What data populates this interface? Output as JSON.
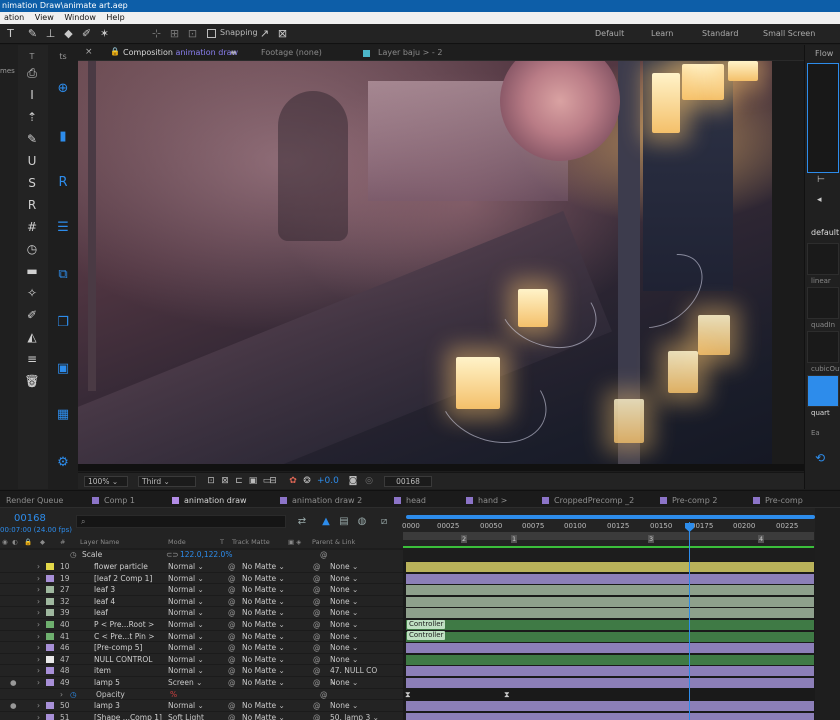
{
  "window": {
    "title": "nimation Draw\\animate art.aep"
  },
  "menu": [
    "ation",
    "View",
    "Window",
    "Help"
  ],
  "toolbar": {
    "snapping_label": "Snapping",
    "workspaces": [
      "Default",
      "Learn",
      "Standard",
      "Small Screen"
    ]
  },
  "left_panel": {
    "partial_label": "mes"
  },
  "comp_tabs": {
    "composition_prefix": "Composition",
    "composition_name": "animation draw",
    "footage": "Footage (none)",
    "layer": "Layer baju > - 2"
  },
  "viewer_bar": {
    "zoom": "100%",
    "resolution": "Third",
    "exposure": "+0.0",
    "timecode": "00168"
  },
  "flow": {
    "title": "Flow",
    "default_label": "default",
    "curves": [
      "linear",
      "quadIn",
      "cubicOut",
      "quart"
    ],
    "selected": "quart",
    "partial_label": "Ea"
  },
  "timeline_tabs": [
    "Render Queue",
    "Comp 1",
    "animation draw",
    "animation draw 2",
    "head",
    "hand >",
    "CroppedPrecomp _2",
    "Pre-comp 2",
    "Pre-comp"
  ],
  "timeline": {
    "timecode": "00168",
    "fps": "00:07:00 (24.00 fps)",
    "search_placeholder": "",
    "columns": {
      "layer_name": "Layer Name",
      "mode": "Mode",
      "t": "T",
      "track_matte": "Track Matte",
      "parent": "Parent & Link"
    },
    "scale_label": "Scale",
    "scale_value": "122.0,122.0%",
    "ruler": [
      "0000",
      "00025",
      "00050",
      "00075",
      "00100",
      "00125",
      "00150",
      "00175",
      "00200",
      "00225"
    ],
    "markers": [
      "2",
      "1",
      "3",
      "4"
    ],
    "layers": [
      {
        "num": "10",
        "name": "flower particle",
        "mode": "Normal",
        "matte": "No Matte",
        "parent": "None",
        "label_color": "#e3d84a",
        "bar_color": "#b9b25a"
      },
      {
        "num": "19",
        "name": "[leaf 2 Comp 1]",
        "mode": "Normal",
        "matte": "No Matte",
        "parent": "None",
        "label_color": "#a890d8",
        "bar_color": "#8c7fb8"
      },
      {
        "num": "27",
        "name": "leaf 3",
        "mode": "Normal",
        "matte": "No Matte",
        "parent": "None",
        "label_color": "#9fb89f",
        "bar_color": "#8ea08c"
      },
      {
        "num": "32",
        "name": "leaf 4",
        "mode": "Normal",
        "matte": "No Matte",
        "parent": "None",
        "label_color": "#9fb89f",
        "bar_color": "#8ea08c"
      },
      {
        "num": "39",
        "name": "leaf",
        "mode": "Normal",
        "matte": "No Matte",
        "parent": "None",
        "label_color": "#9fb89f",
        "bar_color": "#8ea08c"
      },
      {
        "num": "40",
        "name": "P < Pre...Root >",
        "mode": "Normal",
        "matte": "No Matte",
        "parent": "None",
        "label_color": "#6fb06f",
        "bar_color": "#3f7a45"
      },
      {
        "num": "41",
        "name": "C < Pre...t Pin >",
        "mode": "Normal",
        "matte": "No Matte",
        "parent": "None",
        "label_color": "#6fb06f",
        "bar_color": "#3f7a45"
      },
      {
        "num": "46",
        "name": "[Pre-comp 5]",
        "mode": "Normal",
        "matte": "No Matte",
        "parent": "None",
        "label_color": "#a890d8",
        "bar_color": "#8c7fb8"
      },
      {
        "num": "47",
        "name": "NULL CONTROL",
        "mode": "Normal",
        "matte": "No Matte",
        "parent": "None",
        "label_color": "#e8e8e8",
        "bar_color": "#3f7a45"
      },
      {
        "num": "48",
        "name": "item",
        "mode": "Normal",
        "matte": "No Matte",
        "parent": "47. NULL CO",
        "label_color": "#a890d8",
        "bar_color": "#8c7fb8"
      },
      {
        "num": "49",
        "name": "lamp 5",
        "mode": "Screen",
        "matte": "No Matte",
        "parent": "None",
        "label_color": "#a890d8",
        "bar_color": "#8c7fb8"
      },
      {
        "num": "",
        "name": "Opacity",
        "mode": "",
        "matte": "",
        "parent": "",
        "label_color": "",
        "bar_color": ""
      },
      {
        "num": "50",
        "name": "lamp 3",
        "mode": "Normal",
        "matte": "No Matte",
        "parent": "None",
        "label_color": "#a890d8",
        "bar_color": "#8c7fb8"
      },
      {
        "num": "51",
        "name": "[Shape ...Comp 1]",
        "mode": "Soft Light",
        "matte": "No Matte",
        "parent": "50. lamp 3",
        "label_color": "#a890d8",
        "bar_color": "#8c7fb8"
      }
    ],
    "controller_label": "Controller",
    "opacity_value": "%"
  }
}
